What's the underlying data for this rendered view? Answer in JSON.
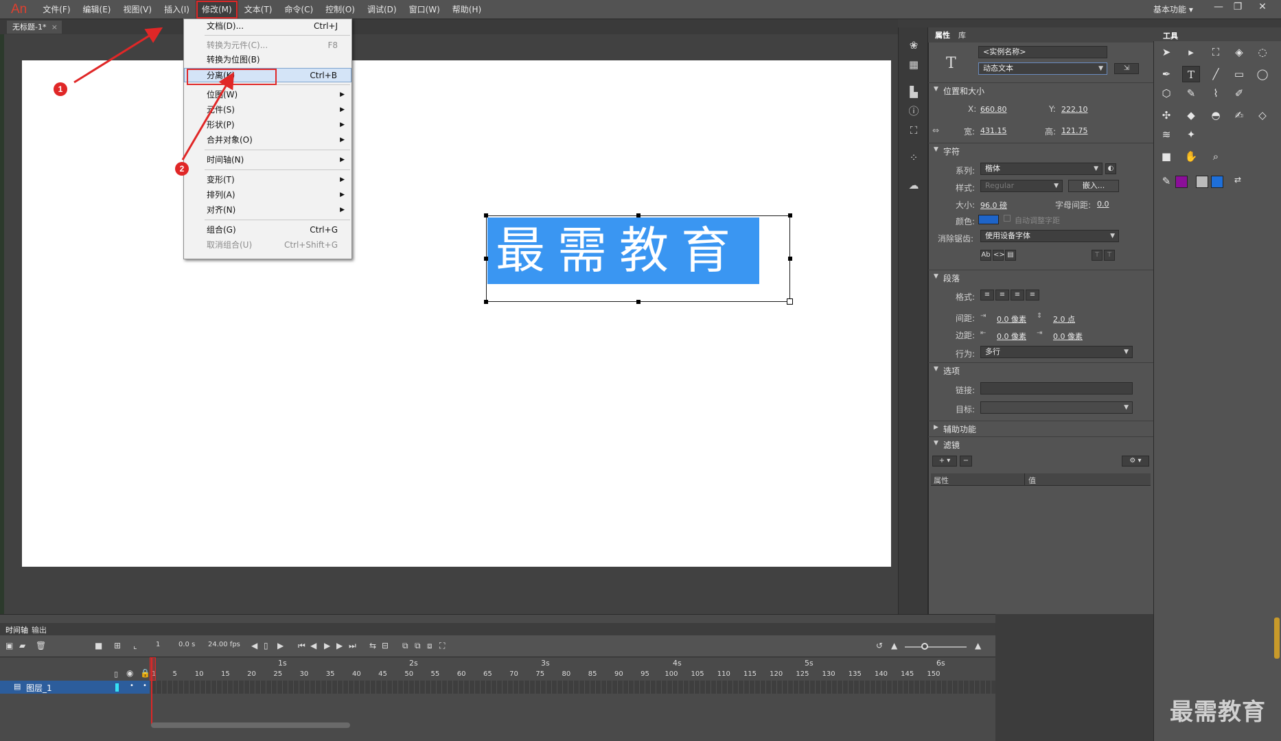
{
  "app": {
    "logo": "An",
    "workspace": "基本功能 ▾"
  },
  "menubar": {
    "items": [
      "文件(F)",
      "编辑(E)",
      "视图(V)",
      "插入(I)",
      "修改(M)",
      "文本(T)",
      "命令(C)",
      "控制(O)",
      "调试(D)",
      "窗口(W)",
      "帮助(H)"
    ],
    "active": "修改(M)"
  },
  "window_controls": {
    "minimize": "—",
    "restore": "❐",
    "close": "✕"
  },
  "document": {
    "tab_title": "无标题-1*",
    "close": "×"
  },
  "stage": {
    "text": "最需教育",
    "text_bg_color": "#3a96f2"
  },
  "modify_menu": {
    "items": [
      {
        "label": "文档(D)...",
        "shortcut": "Ctrl+J",
        "enabled": true
      },
      {
        "label": "转换为元件(C)...",
        "shortcut": "F8",
        "enabled": false
      },
      {
        "label": "转换为位图(B)",
        "shortcut": "",
        "enabled": true
      },
      {
        "label": "分离(K)",
        "shortcut": "Ctrl+B",
        "enabled": true,
        "highlighted": true
      },
      {
        "label": "位图(W)",
        "submenu": true
      },
      {
        "label": "元件(S)",
        "submenu": true
      },
      {
        "label": "形状(P)",
        "submenu": true
      },
      {
        "label": "合并对象(O)",
        "submenu": true
      },
      {
        "label": "时间轴(N)",
        "submenu": true
      },
      {
        "label": "变形(T)",
        "submenu": true
      },
      {
        "label": "排列(A)",
        "submenu": true
      },
      {
        "label": "对齐(N)",
        "submenu": true
      },
      {
        "label": "组合(G)",
        "shortcut": "Ctrl+G",
        "enabled": true
      },
      {
        "label": "取消组合(U)",
        "shortcut": "Ctrl+Shift+G",
        "enabled": false
      }
    ]
  },
  "annotations": {
    "badge1": "1",
    "badge2": "2",
    "color": "#e02727"
  },
  "properties": {
    "tabs": [
      "属性",
      "库"
    ],
    "instance_name_placeholder": "<实例名称>",
    "text_type": "动态文本",
    "position_size": {
      "title": "位置和大小",
      "x_label": "X:",
      "x": "660.80",
      "y_label": "Y:",
      "y": "222.10",
      "w_label": "宽:",
      "w": "431.15",
      "h_label": "高:",
      "h": "121.75"
    },
    "character": {
      "title": "字符",
      "family_label": "系列:",
      "family": "楷体",
      "style_label": "样式:",
      "style": "Regular",
      "embed": "嵌入...",
      "size_label": "大小:",
      "size": "96.0 磅",
      "spacing_label": "字母间距:",
      "spacing": "0.0",
      "color_label": "颜色:",
      "color": "#1e64c8",
      "auto_kern": "自动调整字距",
      "aa_label": "消除锯齿:",
      "aa": "使用设备字体"
    },
    "paragraph": {
      "title": "段落",
      "format_label": "格式:",
      "spacing_label": "间距:",
      "indent": "0.0 像素",
      "line_spacing": "2.0 点",
      "margin_label": "边距:",
      "left_margin": "0.0 像素",
      "right_margin": "0.0 像素",
      "behavior_label": "行为:",
      "behavior": "多行"
    },
    "options": {
      "title": "选项",
      "link_label": "链接:",
      "target_label": "目标:"
    },
    "accessibility": {
      "title": "辅助功能"
    },
    "filters": {
      "title": "滤镜",
      "col_prop": "属性",
      "col_value": "值"
    }
  },
  "tools": {
    "title": "工具",
    "stroke_color": "#8b0e99",
    "fill_color": "#1e6fd9"
  },
  "timeline": {
    "tabs": [
      "时间轴",
      "输出"
    ],
    "current_frame": "1",
    "time": "0.0 s",
    "fps": "24.00 fps",
    "seconds": [
      "1s",
      "2s",
      "3s",
      "4s",
      "5s",
      "6s"
    ],
    "frame_numbers": [
      "1",
      "5",
      "10",
      "15",
      "20",
      "25",
      "30",
      "35",
      "40",
      "45",
      "50",
      "55",
      "60",
      "65",
      "70",
      "75",
      "80",
      "85",
      "90",
      "95",
      "100",
      "105",
      "110",
      "115",
      "120",
      "125",
      "130",
      "135",
      "140",
      "145",
      "150"
    ],
    "layer_name": "图层_1"
  },
  "watermark": "最需教育"
}
